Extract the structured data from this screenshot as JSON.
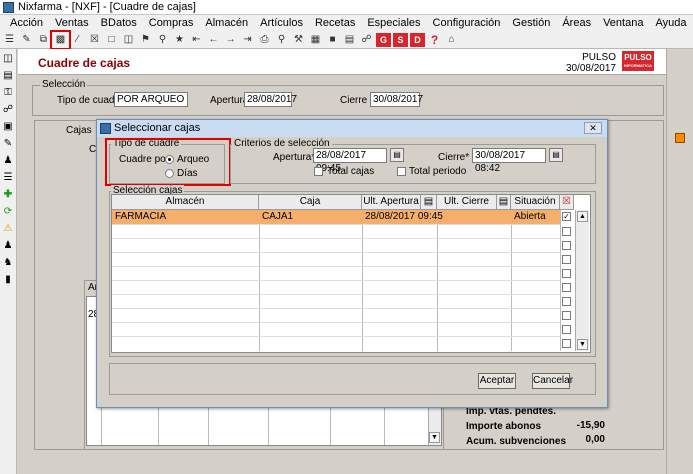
{
  "window": {
    "title": "Nixfarma - [NXF] - [Cuadre de cajas]"
  },
  "menu": [
    "Acción",
    "Ventas",
    "BDatos",
    "Compras",
    "Almacén",
    "Artículos",
    "Recetas",
    "Especiales",
    "Configuración",
    "Gestión",
    "Áreas",
    "Ventana",
    "Ayuda"
  ],
  "toolbar": {
    "g_label": "G",
    "s_label": "S",
    "d_label": "D",
    "help_label": "?"
  },
  "form": {
    "title": "Cuadre de cajas",
    "company": "PULSO",
    "date": "30/08/2017",
    "logo_text": "PULSO",
    "logo_sub": "INFORMATICA",
    "seleccion_label": "Selección",
    "tipo_cuadre_label": "Tipo de cuadre",
    "tipo_cuadre_value": "POR ARQUEO",
    "apertura_label": "Apertura",
    "apertura_value": "28/08/2017",
    "cierre_label": "Cierre",
    "cierre_value": "30/08/2017",
    "cajas_tab_label": "Cajas",
    "bg_c_letter": "C",
    "bg_a_letter": "Ar",
    "bg_28": "28"
  },
  "totals": {
    "imp_label": "Imp. vtas. pendtes.",
    "importe_abonos_label": "Importe abonos",
    "importe_abonos_value": "-15,90",
    "acum_label": "Acum. subvenciones",
    "acum_value": "0,00"
  },
  "modal": {
    "title": "Seleccionar cajas",
    "close_label": "✕",
    "tipo_label": "Tipo de cuadre",
    "cuadre_por_label": "Cuadre por",
    "arqueo_label": "Arqueo",
    "dias_label": "Días",
    "criterios_label": "Criterios de selección",
    "apertura_label": "Apertura*",
    "apertura_value": "28/08/2017 09:45",
    "cierre_label": "Cierre*",
    "cierre_value": "30/08/2017 08:42",
    "total_cajas_label": "Total cajas",
    "total_periodo_label": "Total periodo",
    "seleccion_cajas_label": "Selección cajas",
    "columns": {
      "almacen": "Almacén",
      "caja": "Caja",
      "ult_apertura": "Ult. Apertura",
      "ult_cierre": "Ult. Cierre",
      "situacion": "Situación"
    },
    "rows": [
      {
        "almacen": "FARMACIA",
        "caja": "CAJA1",
        "ult_apertura": "28/08/2017 09:45",
        "ult_cierre": "",
        "situacion": "Abierta",
        "checked": "✓"
      }
    ],
    "aceptar_label": "Aceptar",
    "cancelar_label": "Cancelar"
  },
  "colors": {
    "accent_red": "#e00000",
    "selected_row": "#f5ae6b",
    "title_red": "#8b0000"
  }
}
